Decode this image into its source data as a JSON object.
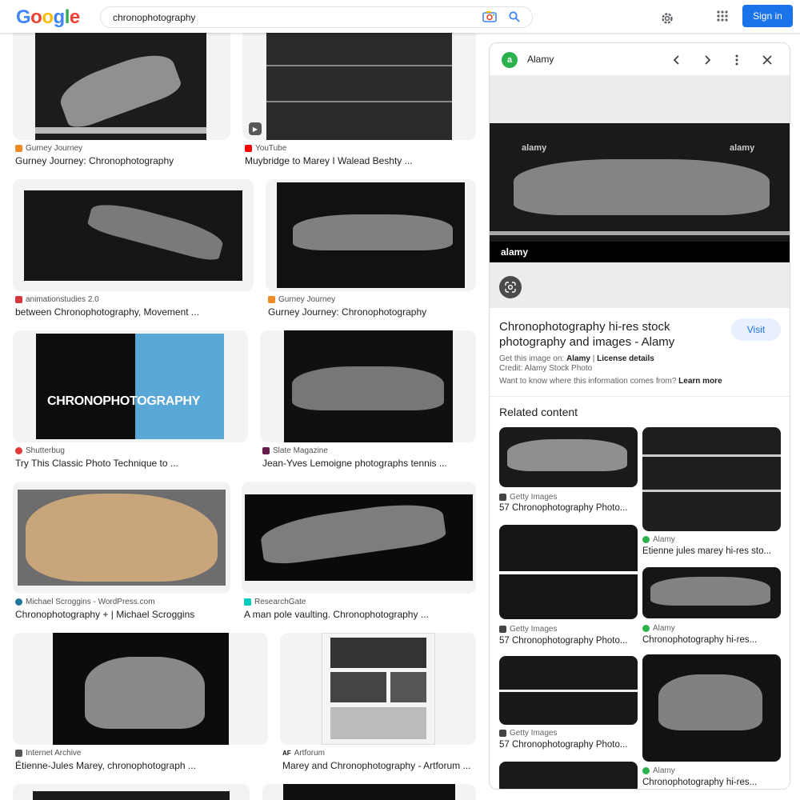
{
  "header": {
    "logo": [
      "G",
      "o",
      "o",
      "g",
      "l",
      "e"
    ],
    "logo_colors": [
      "#4285F4",
      "#EA4335",
      "#FBBC05",
      "#4285F4",
      "#34A853",
      "#EA4335"
    ],
    "search_value": "chronophotography",
    "signin_label": "Sign in"
  },
  "results": [
    {
      "source": "Gurney Journey",
      "title": "Gurney Journey: Chronophotography",
      "favicon_color": "#f08a24"
    },
    {
      "source": "YouTube",
      "title": "Muybridge to Marey I Walead Beshty ...",
      "favicon_color": "#ff0000"
    },
    {
      "source": "animationstudies 2.0",
      "title": "between Chronophotography, Movement ...",
      "favicon_color": "#d9363e"
    },
    {
      "source": "Gurney Journey",
      "title": "Gurney Journey: Chronophotography",
      "favicon_color": "#f08a24"
    },
    {
      "source": "Shutterbug",
      "title": "Try This Classic Photo Technique to ...",
      "favicon_color": "#e53935"
    },
    {
      "source": "Slate Magazine",
      "title": "Jean-Yves Lemoigne photographs tennis ...",
      "favicon_color": "#6a1b4d"
    },
    {
      "source": "Michael Scroggins - WordPress.com",
      "title": "Chronophotography + | Michael Scroggins",
      "favicon_color": "#21759b"
    },
    {
      "source": "ResearchGate",
      "title": "A man pole vaulting. Chronophotography ...",
      "favicon_color": "#00ccbb"
    },
    {
      "source": "Internet Archive",
      "title": "Étienne-Jules Marey, chronophotograph ...",
      "favicon_color": "#555555"
    },
    {
      "source": "Artforum",
      "title": "Marey and Chronophotography - Artforum ...",
      "favicon_color": "#111111"
    }
  ],
  "results_text": {
    "artforum_favicon": "AF",
    "chrono_overlay": "CHRONOPHOTOGRAPHY"
  },
  "panel": {
    "site_name": "Alamy",
    "watermark": "alamy",
    "title": "Chronophotography hi-res stock photography and images - Alamy",
    "visit_label": "Visit",
    "get_image_prefix": "Get this image on:",
    "get_image_site": "Alamy",
    "separator": "|",
    "license": "License details",
    "credit": "Credit: Alamy Stock Photo",
    "want_to_know": "Want to know where this information comes from?",
    "learn_more": "Learn more",
    "related_heading": "Related content",
    "related": [
      {
        "source": "Getty Images",
        "title": "57 Chronophotography Photo..."
      },
      {
        "source": "Alamy",
        "title": "Etienne jules marey hi-res sto..."
      },
      {
        "source": "Getty Images",
        "title": "57 Chronophotography Photo..."
      },
      {
        "source": "Alamy",
        "title": "Chronophotography hi-res..."
      },
      {
        "source": "Getty Images",
        "title": "57 Chronophotography Photo..."
      },
      {
        "source": "Alamy",
        "title": "Chronophotography hi-res..."
      }
    ]
  }
}
